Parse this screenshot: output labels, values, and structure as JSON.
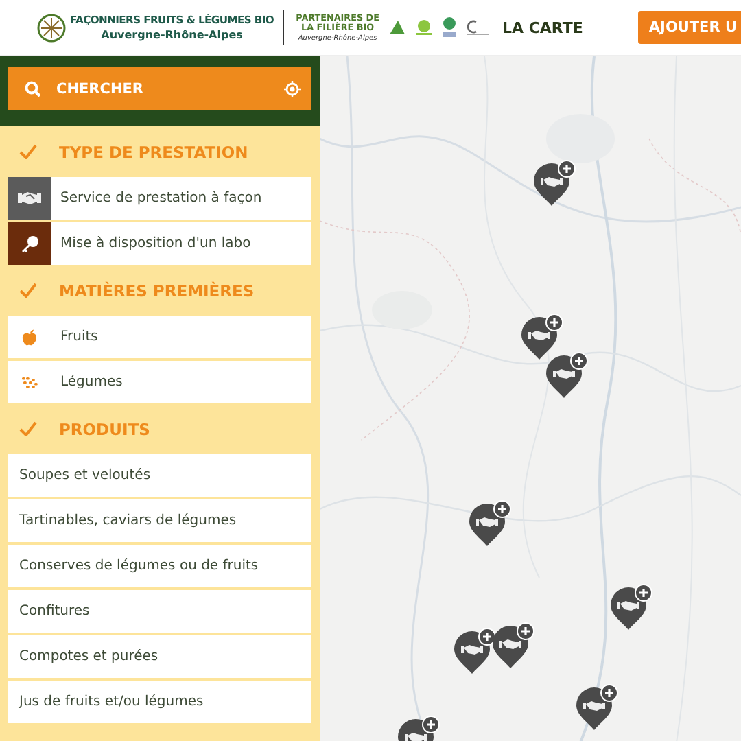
{
  "header": {
    "title": "FAÇONNIERS FRUITS & LÉGUMES BIO",
    "subtitle": "Auvergne-Rhône-Alpes",
    "partners_title": "PARTENAIRES DE LA FILIÈRE BIO",
    "partners_region": "Auvergne-Rhône-Alpes",
    "nav_link": "LA CARTE",
    "cta": "AJOUTER U"
  },
  "search": {
    "label": "CHERCHER"
  },
  "sections": [
    {
      "title": "TYPE DE PRESTATION",
      "checked": true,
      "items": [
        {
          "label": "Service de prestation à façon",
          "kind": "handshake"
        },
        {
          "label": "Mise à disposition d'un labo",
          "kind": "key"
        }
      ]
    },
    {
      "title": "MATIÈRES PREMIÈRES",
      "checked": true,
      "items": [
        {
          "label": "Fruits",
          "kind": "apple"
        },
        {
          "label": "Légumes",
          "kind": "veg"
        }
      ]
    },
    {
      "title": "PRODUITS",
      "checked": true,
      "items": [
        {
          "label": "Soupes et veloutés",
          "kind": "plain"
        },
        {
          "label": "Tartinables, caviars de légumes",
          "kind": "plain"
        },
        {
          "label": "Conserves de légumes ou de fruits",
          "kind": "plain"
        },
        {
          "label": "Confitures",
          "kind": "plain"
        },
        {
          "label": "Compotes et purées",
          "kind": "plain"
        },
        {
          "label": "Jus de fruits et/ou légumes",
          "kind": "plain"
        }
      ]
    }
  ],
  "map": {
    "kind": "picture",
    "markers": [
      {
        "kind": "service"
      },
      {
        "kind": "service"
      },
      {
        "kind": "service"
      },
      {
        "kind": "service"
      },
      {
        "kind": "service"
      },
      {
        "kind": "service"
      },
      {
        "kind": "service"
      },
      {
        "kind": "service"
      },
      {
        "kind": "service"
      }
    ]
  }
}
